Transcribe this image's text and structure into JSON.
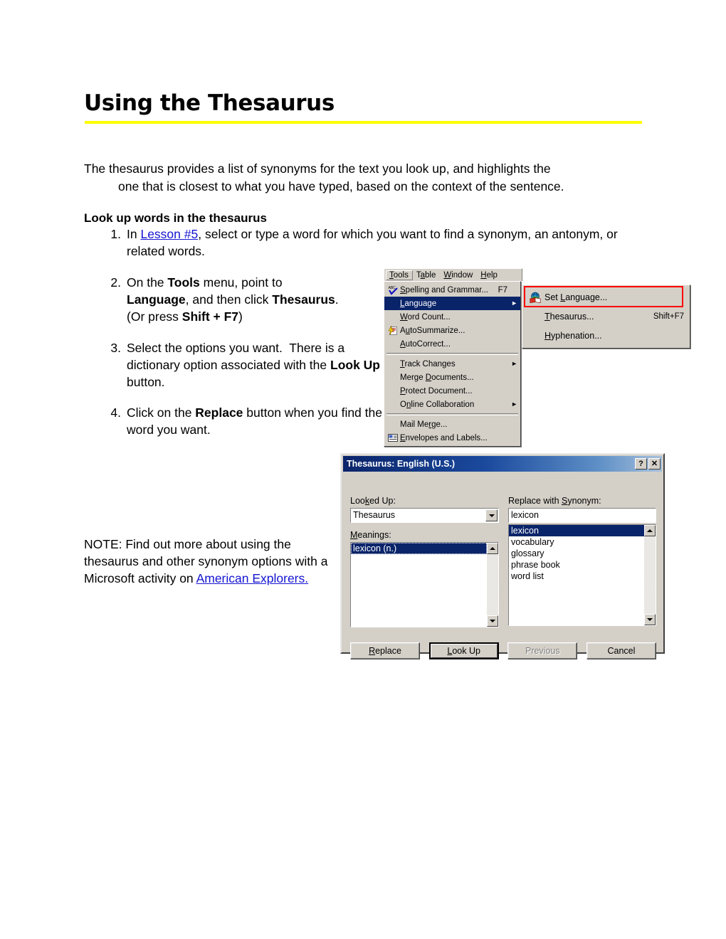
{
  "document": {
    "title": "Using the Thesaurus",
    "intro_line1": "The thesaurus provides a list of synonyms for the text you look up, and highlights the",
    "intro_line2": "one that is closest to what you have typed, based on the context of the sentence.",
    "section_heading": "Look up words in the thesaurus",
    "steps": [
      {
        "num": "1.",
        "pre": "In ",
        "link": "Lesson #5",
        "post": ", select or type a word for which you want to find a synonym, an antonym, or related words."
      },
      {
        "num": "2.",
        "text": "On the Tools menu, point to Language, and then click Thesaurus. (Or press Shift + F7)"
      },
      {
        "num": "3.",
        "text": "Select the options you want.  There is a dictionary option associated with the Look Up button."
      },
      {
        "num": "4.",
        "text": "Click on the Replace button when you find the word you want."
      }
    ],
    "note": {
      "text": "NOTE: Find out more about using the thesaurus and other synonym options with  a Microsoft activity on ",
      "link": "American Explorers."
    },
    "link_color": "#1414d2",
    "rule_color": "#ffff00"
  },
  "tools_menu": {
    "menubar": [
      {
        "label": "Tools",
        "accesskey": "T",
        "active": true
      },
      {
        "label": "Table",
        "accesskey": "a",
        "active": false
      },
      {
        "label": "Window",
        "accesskey": "W",
        "active": false
      },
      {
        "label": "Help",
        "accesskey": "H",
        "active": false
      }
    ],
    "items": [
      {
        "type": "item",
        "label": "Spelling and Grammar...",
        "accel": "F7",
        "icon": "spellcheck-icon",
        "selected": false,
        "submenu": false
      },
      {
        "type": "item",
        "label": "Language",
        "accel": "",
        "icon": "",
        "selected": true,
        "submenu": true
      },
      {
        "type": "item",
        "label": "Word Count...",
        "accel": "",
        "icon": "",
        "selected": false,
        "submenu": false
      },
      {
        "type": "item",
        "label": "AutoSummarize...",
        "accel": "",
        "icon": "autosummarize-icon",
        "selected": false,
        "submenu": false
      },
      {
        "type": "item",
        "label": "AutoCorrect...",
        "accel": "",
        "icon": "",
        "selected": false,
        "submenu": false
      },
      {
        "type": "separator"
      },
      {
        "type": "item",
        "label": "Track Changes",
        "accel": "",
        "icon": "",
        "selected": false,
        "submenu": true
      },
      {
        "type": "item",
        "label": "Merge Documents...",
        "accel": "",
        "icon": "",
        "selected": false,
        "submenu": false
      },
      {
        "type": "item",
        "label": "Protect Document...",
        "accel": "",
        "icon": "",
        "selected": false,
        "submenu": false
      },
      {
        "type": "item",
        "label": "Online Collaboration",
        "accel": "",
        "icon": "",
        "selected": false,
        "submenu": true
      },
      {
        "type": "separator"
      },
      {
        "type": "item",
        "label": "Mail Merge...",
        "accel": "",
        "icon": "",
        "selected": false,
        "submenu": false
      },
      {
        "type": "item",
        "label": "Envelopes and Labels...",
        "accel": "",
        "icon": "envelope-icon",
        "selected": false,
        "submenu": false
      }
    ],
    "highlight_color": "#0a246a",
    "face_color": "#d4d0c8"
  },
  "language_submenu": {
    "items": [
      {
        "label": "Set Language...",
        "accel": "",
        "icon": "globe-book-icon",
        "highlighted": true
      },
      {
        "label": "Thesaurus...",
        "accel": "Shift+F7",
        "icon": "",
        "highlighted": false
      },
      {
        "label": "Hyphenation...",
        "accel": "",
        "icon": "",
        "highlighted": false
      }
    ],
    "callout_color": "#ff0000"
  },
  "thesaurus_dialog": {
    "title": "Thesaurus: English (U.S.)",
    "titlebar_buttons": [
      {
        "name": "help-button",
        "glyph": "?"
      },
      {
        "name": "close-button",
        "glyph": "✕"
      }
    ],
    "looked_up_label": "Looked Up:",
    "looked_up_value": "Thesaurus",
    "meanings_label": "Meanings:",
    "meanings": [
      "lexicon (n.)"
    ],
    "meanings_selected": "lexicon (n.)",
    "replace_label": "Replace with Synonym:",
    "replace_value": "lexicon",
    "synonyms": [
      "lexicon",
      "vocabulary",
      "glossary",
      "phrase book",
      "word list"
    ],
    "synonym_selected": "lexicon",
    "buttons": [
      {
        "label": "Replace",
        "state": "normal"
      },
      {
        "label": "Look Up",
        "state": "default"
      },
      {
        "label": "Previous",
        "state": "disabled"
      },
      {
        "label": "Cancel",
        "state": "normal"
      }
    ]
  }
}
